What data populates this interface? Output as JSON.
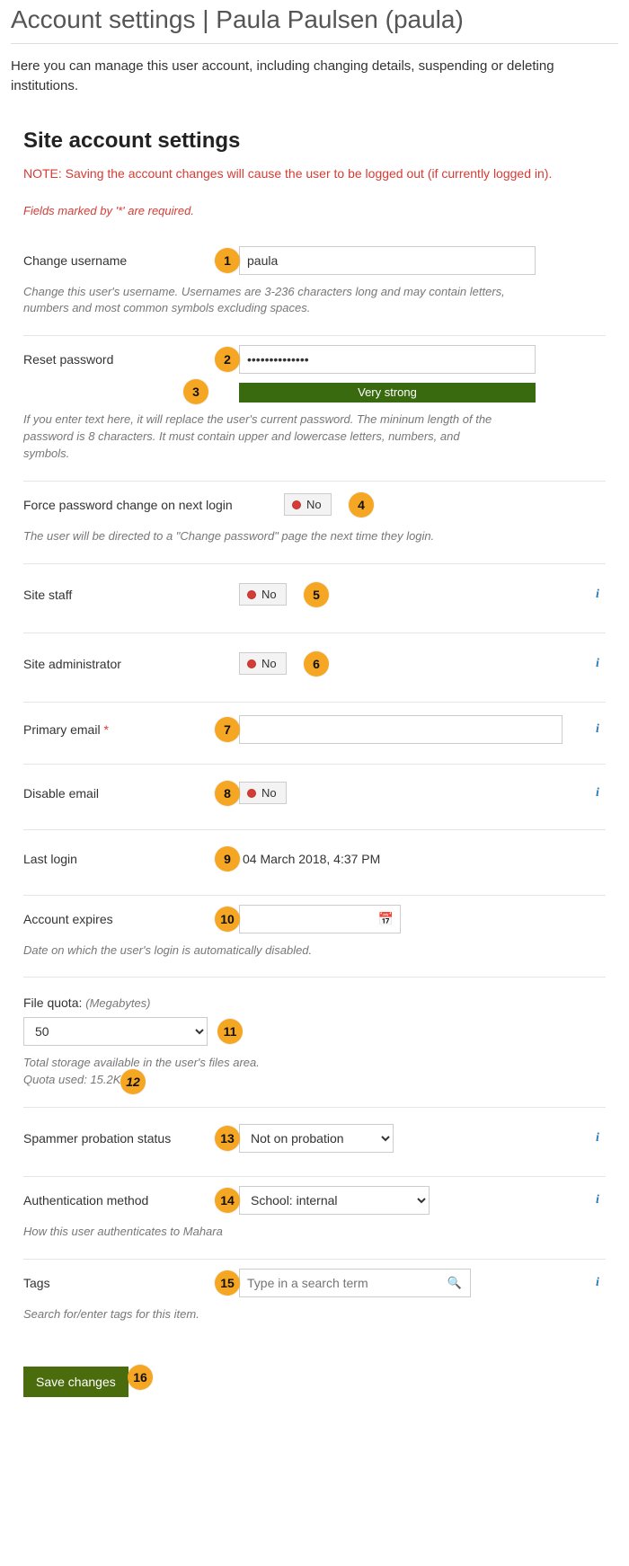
{
  "page": {
    "title": "Account settings | Paula Paulsen (paula)",
    "description": "Here you can manage this user account, including changing details, suspending or deleting institutions."
  },
  "section": {
    "title": "Site account settings",
    "note": "NOTE: Saving the account changes will cause the user to be logged out (if currently logged in).",
    "required_note": "Fields marked by '*' are required."
  },
  "badges": {
    "b1": "1",
    "b2": "2",
    "b3": "3",
    "b4": "4",
    "b5": "5",
    "b6": "6",
    "b7": "7",
    "b8": "8",
    "b9": "9",
    "b10": "10",
    "b11": "11",
    "b12": "12",
    "b13": "13",
    "b14": "14",
    "b15": "15",
    "b16": "16"
  },
  "fields": {
    "username": {
      "label": "Change username",
      "value": "paula",
      "help": "Change this user's username. Usernames are 3-236 characters long and may contain letters, numbers and most common symbols excluding spaces."
    },
    "password": {
      "label": "Reset password",
      "value": "••••••••••••••",
      "strength_label": "Very strong",
      "help": "If you enter text here, it will replace the user's current password. The mininum length of the password is 8 characters. It must contain upper and lowercase letters, numbers, and symbols."
    },
    "force_pw": {
      "label": "Force password change on next login",
      "value": "No",
      "help": "The user will be directed to a \"Change password\" page the next time they login."
    },
    "site_staff": {
      "label": "Site staff",
      "value": "No"
    },
    "site_admin": {
      "label": "Site administrator",
      "value": "No"
    },
    "primary_email": {
      "label": "Primary email ",
      "value": ""
    },
    "disable_email": {
      "label": "Disable email",
      "value": "No"
    },
    "last_login": {
      "label": "Last login",
      "value": "04 March 2018, 4:37 PM"
    },
    "expires": {
      "label": "Account expires",
      "value": "",
      "help": "Date on which the user's login is automatically disabled."
    },
    "file_quota": {
      "label": "File quota:",
      "unit": "(Megabytes)",
      "value": "50",
      "help1": "Total storage available in the user's files area.",
      "help2": "Quota used: 15.2KB"
    },
    "probation": {
      "label": "Spammer probation status",
      "value": "Not on probation"
    },
    "auth": {
      "label": "Authentication method",
      "value": "School: internal",
      "help": "How this user authenticates to Mahara"
    },
    "tags": {
      "label": "Tags",
      "placeholder": "Type in a search term",
      "help": "Search for/enter tags for this item."
    }
  },
  "buttons": {
    "save": "Save changes"
  },
  "info_icon": "i"
}
